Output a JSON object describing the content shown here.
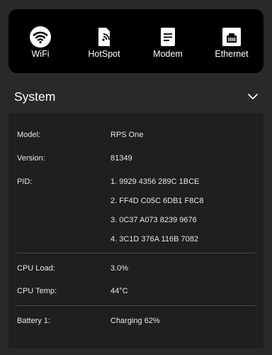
{
  "connectivity": [
    {
      "label": "WiFi",
      "icon": "wifi-icon"
    },
    {
      "label": "HotSpot",
      "icon": "hotspot-icon"
    },
    {
      "label": "Modem",
      "icon": "modem-icon"
    },
    {
      "label": "Ethernet",
      "icon": "ethernet-icon"
    }
  ],
  "system": {
    "title": "System",
    "chevron_icon": "chevron-down-icon",
    "model_label": "Model:",
    "model_value": "RPS One",
    "version_label": "Version:",
    "version_value": "81349",
    "pid_label": "PID:",
    "pid_values": [
      "1. 9929 4356 289C 1BCE",
      "2. FF4D C05C 6DB1 F8C8",
      "3. 0C37 A073 8239 9676",
      "4. 3C1D 376A 116B 7082"
    ],
    "cpu_load_label": "CPU Load:",
    "cpu_load_value": "3.0%",
    "cpu_temp_label": "CPU Temp:",
    "cpu_temp_value": "44°C",
    "battery_label": "Battery 1:",
    "battery_value": "Charging 62%"
  },
  "colors": {
    "background": "#292929",
    "topbar": "#000000",
    "panel": "#1f1f1f",
    "text": "#ffffff"
  }
}
